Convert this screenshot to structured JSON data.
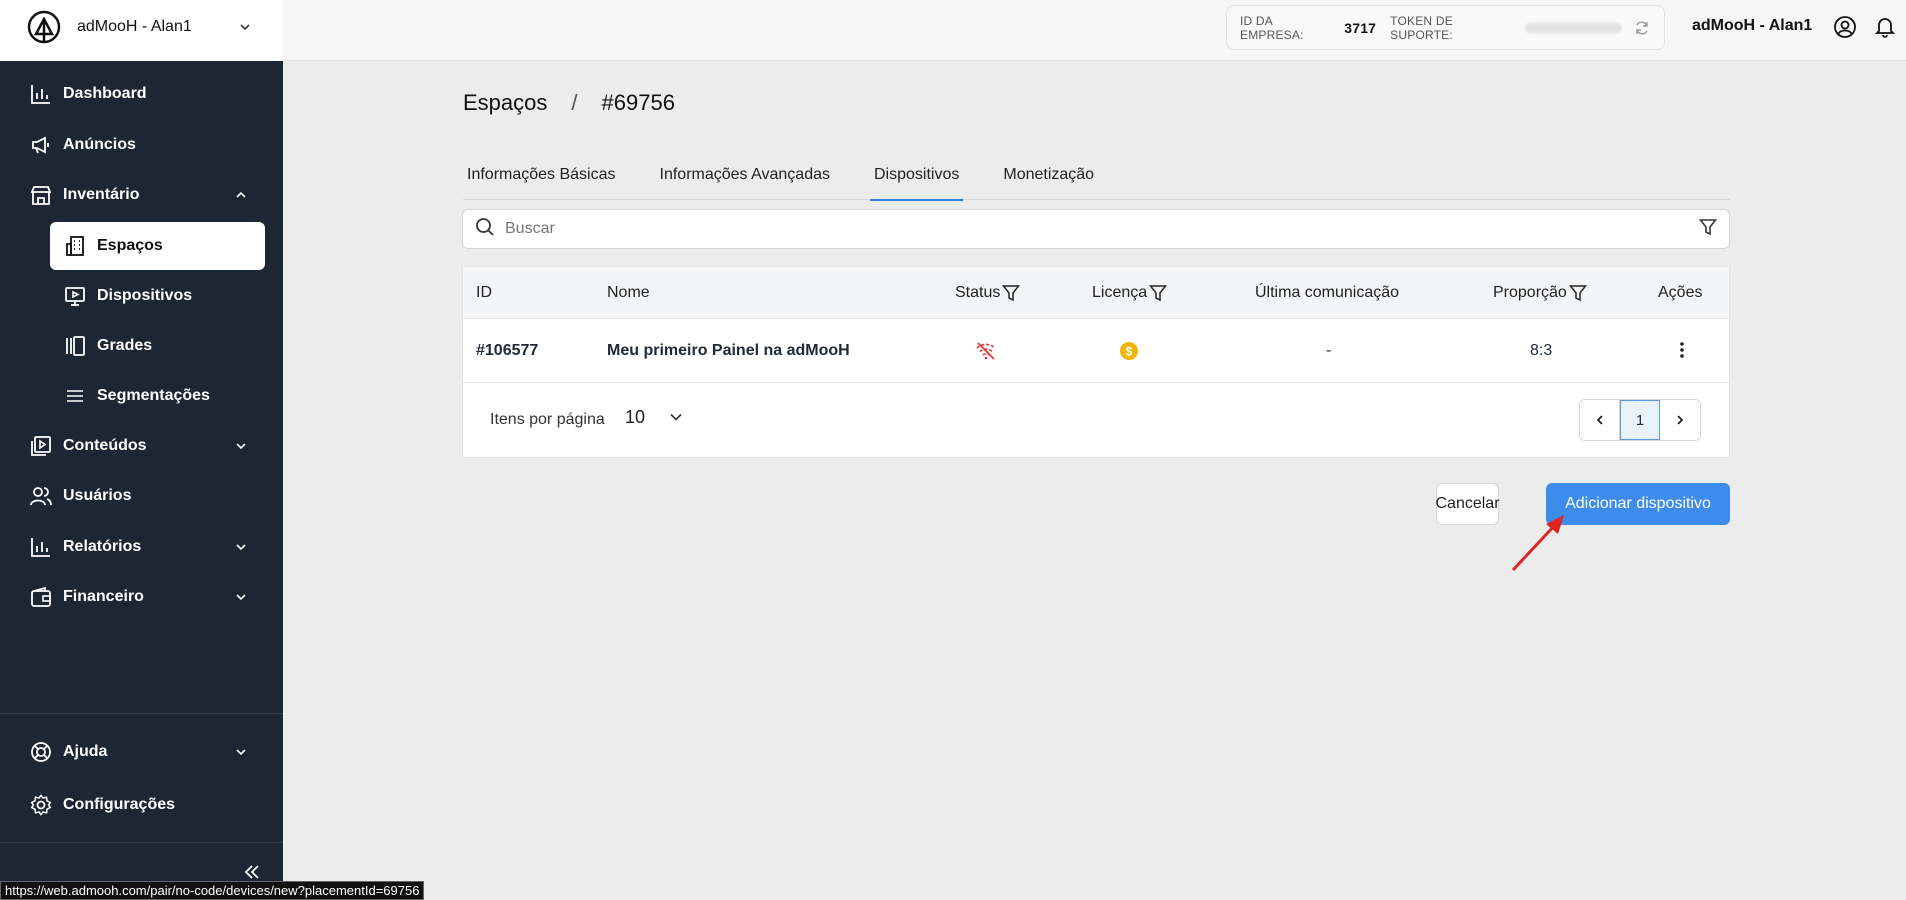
{
  "org": {
    "name": "adMooH - Alan1"
  },
  "sidebar": {
    "items": [
      {
        "label": "Dashboard",
        "icon": "bar-chart-icon"
      },
      {
        "label": "Anúncios",
        "icon": "megaphone-icon"
      },
      {
        "label": "Inventário",
        "icon": "store-icon",
        "expanded": true
      }
    ],
    "subitems": [
      {
        "label": "Espaços",
        "icon": "building-icon",
        "active": true
      },
      {
        "label": "Dispositivos",
        "icon": "monitor-play-icon"
      },
      {
        "label": "Grades",
        "icon": "gallery-icon"
      },
      {
        "label": "Segmentações",
        "icon": "menu-icon"
      }
    ],
    "items2": [
      {
        "label": "Conteúdos",
        "icon": "play-square-icon"
      },
      {
        "label": "Usuários",
        "icon": "users-icon"
      },
      {
        "label": "Relatórios",
        "icon": "bar-chart-icon"
      },
      {
        "label": "Financeiro",
        "icon": "wallet-icon"
      }
    ],
    "bottom": [
      {
        "label": "Ajuda",
        "icon": "lifebuoy-icon"
      },
      {
        "label": "Configurações",
        "icon": "gear-icon"
      }
    ]
  },
  "header": {
    "company_id_label": "ID DA EMPRESA:",
    "company_id": "3717",
    "token_label": "TOKEN DE SUPORTE:",
    "user_name": "adMooH - Alan1"
  },
  "breadcrumb": {
    "parent": "Espaços",
    "separator": "/",
    "current": "#69756"
  },
  "tabs": [
    {
      "label": "Informações Básicas"
    },
    {
      "label": "Informações Avançadas"
    },
    {
      "label": "Dispositivos",
      "active": true
    },
    {
      "label": "Monetização"
    }
  ],
  "search": {
    "placeholder": "Buscar"
  },
  "table": {
    "headers": [
      "ID",
      "Nome",
      "Status",
      "Licença",
      "Última comunicação",
      "Proporção",
      "Ações"
    ],
    "rows": [
      {
        "id": "#106577",
        "name": "Meu primeiro Painel na adMooH",
        "status": "wifi-off-icon",
        "license": "coin-icon",
        "last_comm": "-",
        "ratio": "8:3"
      }
    ]
  },
  "pagination": {
    "per_page_label": "Itens por página",
    "per_page": "10",
    "current_page": "1"
  },
  "actions": {
    "cancel": "Cancelar",
    "add": "Adicionar dispositivo"
  },
  "status_bar": {
    "url": "https://web.admooh.com/pair/no-code/devices/new?placementId=69756"
  },
  "colors": {
    "sidebar": "#1c2733",
    "primary": "#3d8bea",
    "accent_tab": "#2f7de1",
    "status_off": "#e03131",
    "license": "#f2b705",
    "arrow": "#e02424"
  }
}
